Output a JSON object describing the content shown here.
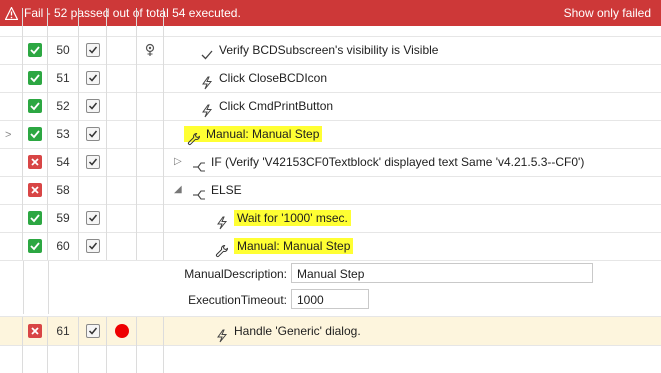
{
  "banner": {
    "title": "Fail - 52 passed out of total 54 executed.",
    "toggle_label": "Show only failed",
    "color": "#cd3838"
  },
  "rows": [
    {
      "num": "50",
      "status": "pass",
      "text": "Verify BCDSubscreen's visibility is Visible",
      "icon": "check-icon",
      "indent": 200,
      "highlight": false
    },
    {
      "num": "51",
      "status": "pass",
      "text": "Click CloseBCDIcon",
      "icon": "lightning-icon",
      "indent": 200,
      "highlight": false
    },
    {
      "num": "52",
      "status": "pass",
      "text": "Click CmdPrintButton",
      "icon": "lightning-icon",
      "indent": 200,
      "highlight": false
    },
    {
      "num": "53",
      "status": "pass",
      "text": "Manual: Manual Step",
      "icon": "wrench-icon",
      "indent": 200,
      "highlight": true
    },
    {
      "num": "54",
      "status": "fail",
      "text": "IF (Verify 'V42153CF0Textblock' displayed text Same 'v4.21.5.3--CF0')",
      "icon": "branch-icon",
      "indent": 200,
      "highlight": false
    },
    {
      "num": "58",
      "status": "fail",
      "text": "ELSE",
      "icon": "branch-icon",
      "indent": 200,
      "highlight": false
    },
    {
      "num": "59",
      "status": "pass",
      "text": "Wait for '1000' msec.",
      "icon": "lightning-icon",
      "indent": 220,
      "highlight": true
    },
    {
      "num": "60",
      "status": "pass",
      "text": "Manual: Manual Step",
      "icon": "wrench-icon",
      "indent": 220,
      "highlight": true
    },
    {
      "num": "61",
      "status": "fail",
      "text": "Handle 'Generic' dialog.",
      "icon": "lightning-icon",
      "indent": 220,
      "highlight": false
    }
  ],
  "properties": {
    "manual_description_label": "ManualDescription:",
    "manual_description_value": "Manual Step",
    "execution_timeout_label": "ExecutionTimeout:",
    "execution_timeout_value": "1000"
  },
  "colors": {
    "pass": "#2ca742",
    "fail": "#d84545",
    "highlight": "#ffff33",
    "breakpoint": "#ee0000"
  }
}
